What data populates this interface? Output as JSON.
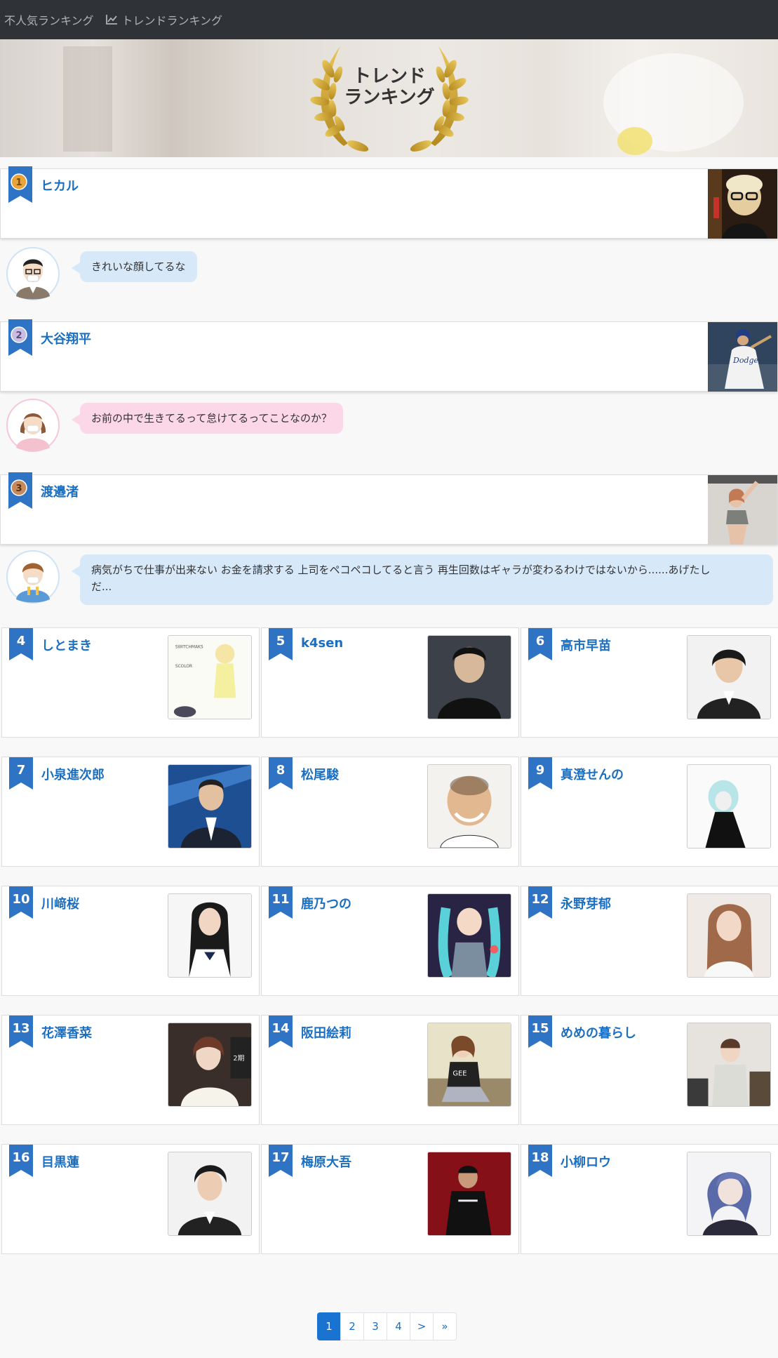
{
  "nav": {
    "items": [
      {
        "label": "不人気ランキング",
        "icon": "fire-icon"
      },
      {
        "label": "トレンドランキング",
        "icon": "line-chart-icon"
      }
    ]
  },
  "hero": {
    "title_line1": "トレンド",
    "title_line2": "ランキング",
    "laurel_color": "#c9a02a"
  },
  "top_rankings": [
    {
      "rank": "1",
      "name": "ヒカル",
      "medal": "gold",
      "medal_color": "#e8a33a",
      "comment": "きれいな顔してるな",
      "commenter": "man-glasses-avatar",
      "bubble": "blue"
    },
    {
      "rank": "2",
      "name": "大谷翔平",
      "medal": "silver",
      "medal_color": "#b9a8d6",
      "comment": "お前の中で生きてるって怠けてるってことなのか？",
      "commenter": "woman-avatar",
      "bubble": "pink"
    },
    {
      "rank": "3",
      "name": "渡邉渚",
      "medal": "bronze",
      "medal_color": "#c78a5c",
      "comment_line1": "病気がちで仕事が出来ない お金を請求する 上司をペコペコしてると言う 再生回数はギャラが変わるわけではないから......あげたし",
      "comment_line2": "だ...",
      "commenter": "boy-avatar",
      "bubble": "blue"
    }
  ],
  "grid_rankings": [
    {
      "rank": "4",
      "name": "しとまき"
    },
    {
      "rank": "5",
      "name": "k4sen"
    },
    {
      "rank": "6",
      "name": "高市早苗"
    },
    {
      "rank": "7",
      "name": "小泉進次郎"
    },
    {
      "rank": "8",
      "name": "松尾駿"
    },
    {
      "rank": "9",
      "name": "真澄せんの"
    },
    {
      "rank": "10",
      "name": "川﨑桜"
    },
    {
      "rank": "11",
      "name": "鹿乃つの"
    },
    {
      "rank": "12",
      "name": "永野芽郁"
    },
    {
      "rank": "13",
      "name": "花澤香菜"
    },
    {
      "rank": "14",
      "name": "阪田絵莉"
    },
    {
      "rank": "15",
      "name": "めめの暮らし"
    },
    {
      "rank": "16",
      "name": "目黒蓮"
    },
    {
      "rank": "17",
      "name": "梅原大吾"
    },
    {
      "rank": "18",
      "name": "小柳ロウ"
    }
  ],
  "pagination": {
    "pages": [
      "1",
      "2",
      "3",
      "4"
    ],
    "next": ">",
    "last": "»",
    "current": "1"
  },
  "colors": {
    "accent": "#1a6fc2",
    "ribbon": "#2f73c4",
    "nav_bg": "#2f3236"
  }
}
